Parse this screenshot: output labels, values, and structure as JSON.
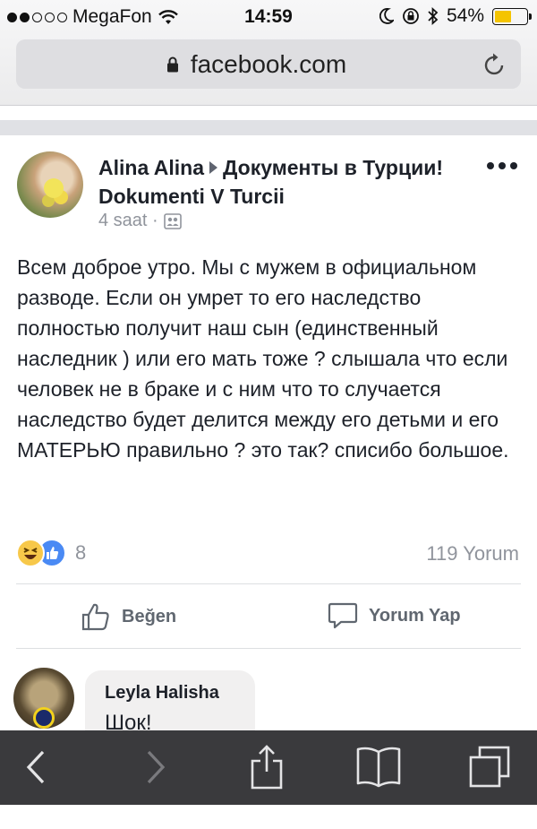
{
  "status_bar": {
    "carrier": "MegaFon",
    "time": "14:59",
    "battery": "54%",
    "battery_level": 0.54
  },
  "browser": {
    "url": "facebook.com"
  },
  "post": {
    "author": "Alina Alina",
    "group": "Документы в Турции! Dokumenti V Turcii",
    "time": "4 saat ·",
    "text": "Всем доброе утро. Мы с мужем в официальном разводе. Если он умрет то его наследство полностью получит наш сын (единственный наследник ) или его мать тоже ? слышала что если человек не в браке и с ним что то случается наследство будет делится между его детьми и его МАТЕРЬЮ правильно ? это так? списибо большое.",
    "reaction_count": "8",
    "comment_count": "119 Yorum",
    "actions": {
      "like": "Beğen",
      "comment": "Yorum Yap"
    }
  },
  "comment": {
    "author": "Leyla Halisha",
    "text": "Шок!"
  },
  "toolbar": {
    "icons": [
      "back-icon",
      "forward-icon",
      "share-icon",
      "bookmarks-icon",
      "tabs-icon"
    ]
  },
  "colors": {
    "accent_like": "#4a8af4",
    "haha": "#f7c84a",
    "toolbar_bg": "#3a3a3d"
  }
}
